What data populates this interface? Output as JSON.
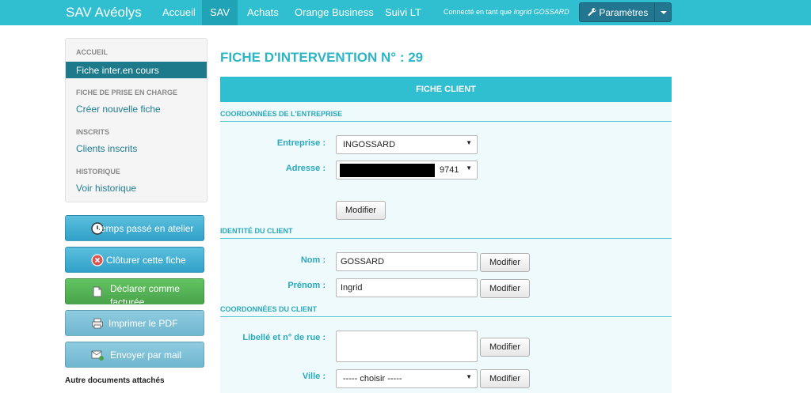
{
  "navbar": {
    "brand": "SAV Avéolys",
    "items": [
      {
        "label": "Accueil",
        "active": false
      },
      {
        "label": "SAV",
        "active": true
      },
      {
        "label": "Achats",
        "active": false
      },
      {
        "label": "Orange Business",
        "active": false
      },
      {
        "label": "Suivi LT",
        "active": false
      }
    ],
    "connected_prefix": "Connecté en tant que",
    "connected_user": "Ingrid GOSSARD",
    "settings_label": "Paramètres"
  },
  "sidebar": {
    "sections": [
      {
        "header": "ACCUEIL",
        "link": "Fiche inter.en cours",
        "active": true
      },
      {
        "header": "FICHE DE PRISE EN CHARGE",
        "link": "Créer nouvelle fiche",
        "active": false
      },
      {
        "header": "INSCRITS",
        "link": "Clients inscrits",
        "active": false
      },
      {
        "header": "HISTORIQUE",
        "link": "Voir historique",
        "active": false
      }
    ],
    "actions": [
      {
        "label": "Temps passé en atelier",
        "icon": "clock-icon",
        "style": "blue"
      },
      {
        "label": "Clôturer cette fiche",
        "icon": "close-circle-icon",
        "style": "blue"
      },
      {
        "label": "Déclarer comme facturée",
        "icon": "document-icon",
        "style": "green"
      },
      {
        "label": "Imprimer le PDF",
        "icon": "printer-icon",
        "style": "lightblue"
      },
      {
        "label": "Envoyer par mail",
        "icon": "mail-icon",
        "style": "lightblue"
      }
    ],
    "docs_title": "Autre documents attachés"
  },
  "main": {
    "title": "FICHE D'INTERVENTION N° : 29",
    "panel_title": "FICHE CLIENT",
    "company_section": "COORDONNÉES DE L'ENTREPRISE",
    "company_label": "Entreprise :",
    "company_value": "INGOSSARD",
    "address_label": "Adresse :",
    "address_value_suffix": "9741",
    "modify_label": "Modifier",
    "identity_section": "IDENTITÉ DU CLIENT",
    "lastname_label": "Nom :",
    "lastname_value": "GOSSARD",
    "firstname_label": "Prénom :",
    "firstname_value": "Ingrid",
    "contact_section": "COORDONNÉES DU CLIENT",
    "street_label": "Libellé et n° de rue :",
    "street_value": "",
    "city_label": "Ville :",
    "city_value": "----- choisir -----"
  }
}
